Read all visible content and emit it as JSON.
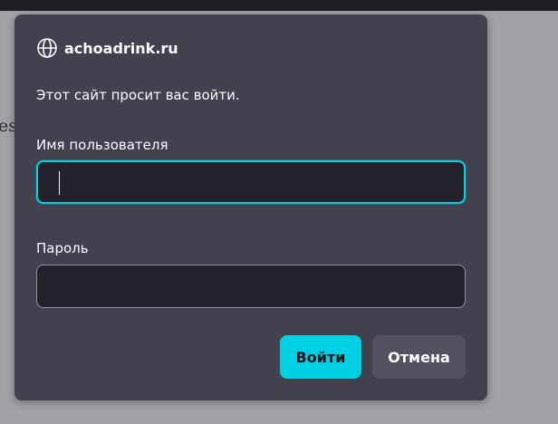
{
  "background": {
    "partial_text": "es"
  },
  "dialog": {
    "site_icon": "globe-icon",
    "site_host": "achoadrink.ru",
    "prompt": "Этот сайт просит вас войти.",
    "username": {
      "label": "Имя пользователя",
      "value": "",
      "placeholder": ""
    },
    "password": {
      "label": "Пароль",
      "value": "",
      "placeholder": ""
    },
    "buttons": {
      "ok_label": "Войти",
      "cancel_label": "Отмена"
    }
  },
  "colors": {
    "dialog_bg": "#42414d",
    "input_bg": "#23222b",
    "accent": "#00d0e3",
    "page_bg": "#a3a3a7"
  }
}
